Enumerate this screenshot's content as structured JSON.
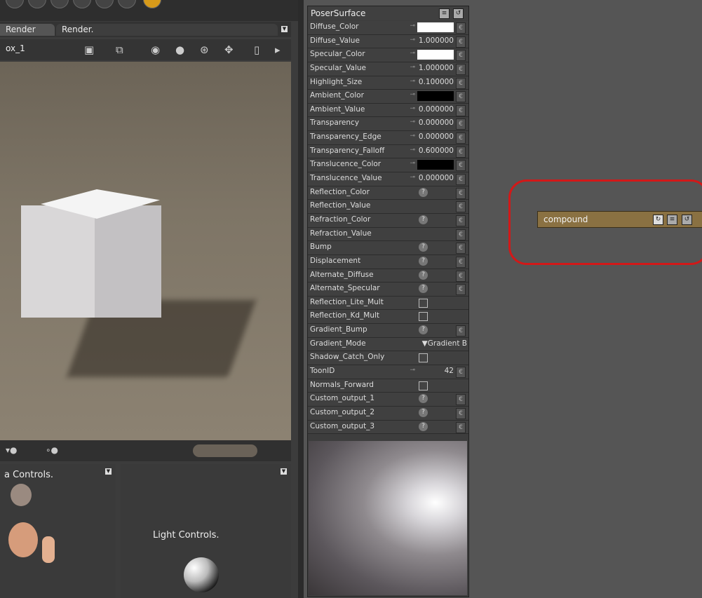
{
  "left_panel": {
    "tabs": [
      "Render",
      "Render."
    ],
    "camera_name": "ox_1",
    "camera_controls_label": "a Controls.",
    "light_controls_label": "Light Controls.",
    "toolbar_icons": [
      "camera-icon",
      "camera-alt-icon",
      "eye-icon",
      "sphere-icon",
      "globe-icon",
      "move-icon",
      "bulb-icon",
      "arrow-right-icon"
    ]
  },
  "node": {
    "title": "PoserSurface",
    "rows": [
      {
        "label": "Diffuse_Color",
        "kind": "color",
        "color": "#ffffff"
      },
      {
        "label": "Diffuse_Value",
        "kind": "value",
        "value": "1.000000"
      },
      {
        "label": "Specular_Color",
        "kind": "color",
        "color": "#ffffff"
      },
      {
        "label": "Specular_Value",
        "kind": "value",
        "value": "1.000000"
      },
      {
        "label": "Highlight_Size",
        "kind": "value",
        "value": "0.100000"
      },
      {
        "label": "Ambient_Color",
        "kind": "color",
        "color": "#000000"
      },
      {
        "label": "Ambient_Value",
        "kind": "value",
        "value": "0.000000"
      },
      {
        "label": "Transparency",
        "kind": "value",
        "value": "0.000000"
      },
      {
        "label": "Transparency_Edge",
        "kind": "value",
        "value": "0.000000"
      },
      {
        "label": "Transparency_Falloff",
        "kind": "value",
        "value": "0.600000"
      },
      {
        "label": "Translucence_Color",
        "kind": "color",
        "color": "#000000"
      },
      {
        "label": "Translucence_Value",
        "kind": "value",
        "value": "0.000000"
      },
      {
        "label": "Reflection_Color",
        "kind": "q"
      },
      {
        "label": "Reflection_Value",
        "kind": "plug"
      },
      {
        "label": "Refraction_Color",
        "kind": "q"
      },
      {
        "label": "Refraction_Value",
        "kind": "plug"
      },
      {
        "label": "Bump",
        "kind": "q"
      },
      {
        "label": "Displacement",
        "kind": "q"
      },
      {
        "label": "Alternate_Diffuse",
        "kind": "q"
      },
      {
        "label": "Alternate_Specular",
        "kind": "q"
      },
      {
        "label": "Reflection_Lite_Mult",
        "kind": "check"
      },
      {
        "label": "Reflection_Kd_Mult",
        "kind": "check"
      },
      {
        "label": "Gradient_Bump",
        "kind": "q"
      },
      {
        "label": "Gradient_Mode",
        "kind": "select",
        "value": "▼Gradient B"
      },
      {
        "label": "Shadow_Catch_Only",
        "kind": "check"
      },
      {
        "label": "ToonID",
        "kind": "value",
        "value": "42"
      },
      {
        "label": "Normals_Forward",
        "kind": "check"
      },
      {
        "label": "Custom_output_1",
        "kind": "q"
      },
      {
        "label": "Custom_output_2",
        "kind": "q"
      },
      {
        "label": "Custom_output_3",
        "kind": "q"
      }
    ]
  },
  "compound_node": {
    "title": "compound"
  },
  "colors": {
    "highlight": "#d21818",
    "compound_bg": "#8a7142"
  }
}
